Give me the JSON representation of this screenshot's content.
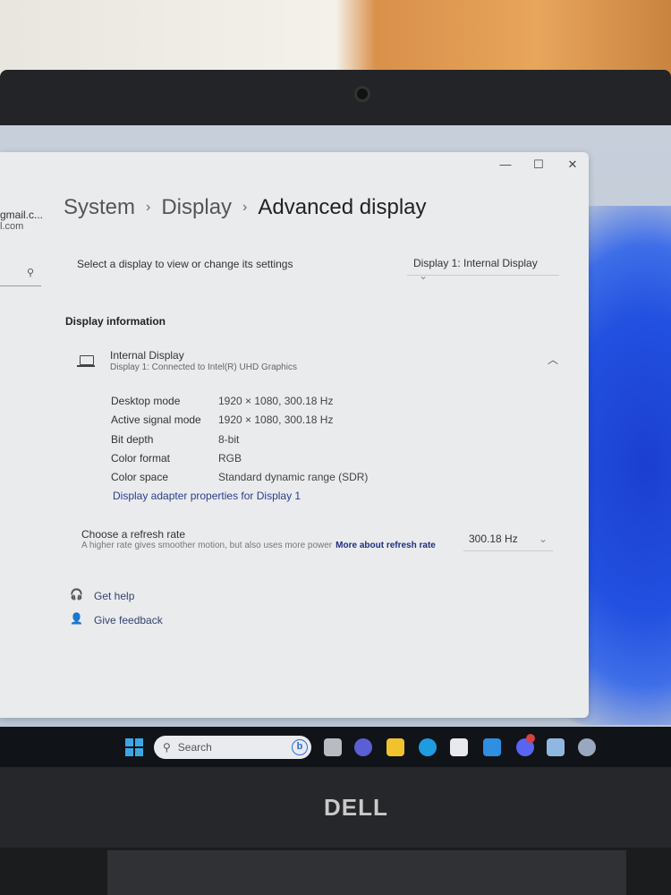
{
  "window": {
    "controls": {
      "minimize": "—",
      "maximize": "☐",
      "close": "✕"
    }
  },
  "account": {
    "email_line1": "gmail.c...",
    "email_line2": "l.com"
  },
  "sidebar": {
    "search_icon": "search-icon"
  },
  "breadcrumb": {
    "items": [
      "System",
      "Display",
      "Advanced display"
    ],
    "separator": "›"
  },
  "display_select": {
    "label": "Select a display to view or change its settings",
    "value": "Display 1: Internal Display"
  },
  "display_info": {
    "heading": "Display information",
    "name": "Internal Display",
    "subtitle": "Display 1: Connected to Intel(R) UHD Graphics",
    "rows": [
      {
        "label": "Desktop mode",
        "value": "1920 × 1080, 300.18 Hz"
      },
      {
        "label": "Active signal mode",
        "value": "1920 × 1080, 300.18 Hz"
      },
      {
        "label": "Bit depth",
        "value": "8-bit"
      },
      {
        "label": "Color format",
        "value": "RGB"
      },
      {
        "label": "Color space",
        "value": "Standard dynamic range (SDR)"
      }
    ],
    "adapter_link": "Display adapter properties for Display 1"
  },
  "refresh_rate": {
    "label": "Choose a refresh rate",
    "description": "A higher rate gives smoother motion, but also uses more power",
    "link": "More about refresh rate",
    "value": "300.18 Hz"
  },
  "footer_links": {
    "help": "Get help",
    "feedback": "Give feedback"
  },
  "taskbar": {
    "search_placeholder": "Search",
    "apps": [
      "task-view",
      "teams",
      "file-explorer",
      "edge",
      "store",
      "mail",
      "discord",
      "task-manager",
      "settings"
    ],
    "colors": [
      "#b8bcc2",
      "#5a5fd6",
      "#f2c12e",
      "#1f9be0",
      "#e8e8ee",
      "#2f8fe0",
      "#5865f2",
      "#8fb8e0",
      "#9aa7c0"
    ]
  },
  "brand": "DELL",
  "colors": {
    "accent_link": "#2a3e8c",
    "window_bg": "#eaebed"
  }
}
